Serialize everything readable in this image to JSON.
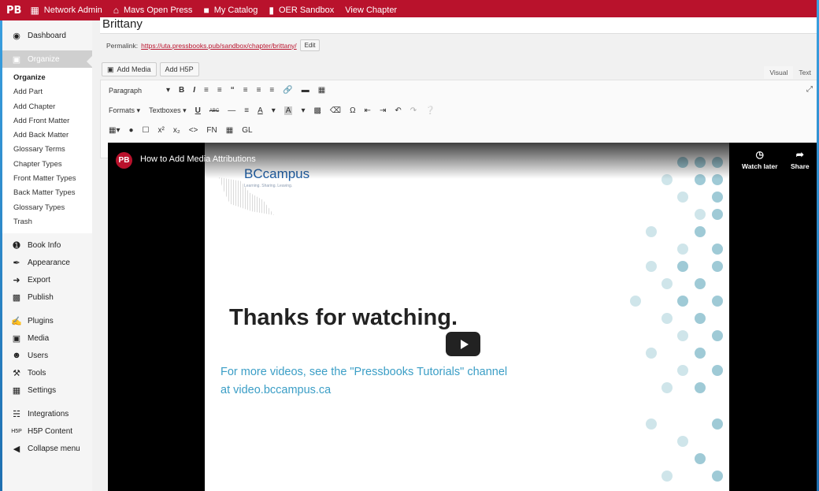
{
  "adminbar": {
    "logo": "PB",
    "items": [
      {
        "icon": "network-icon",
        "label": "Network Admin"
      },
      {
        "icon": "home-icon",
        "label": "Mavs Open Press"
      },
      {
        "icon": "folder-icon",
        "label": "My Catalog"
      },
      {
        "icon": "book-icon",
        "label": "OER Sandbox"
      },
      {
        "icon": "",
        "label": "View Chapter"
      }
    ]
  },
  "sidebar": {
    "dashboard": "Dashboard",
    "organize": "Organize",
    "submenu": [
      "Organize",
      "Add Part",
      "Add Chapter",
      "Add Front Matter",
      "Add Back Matter",
      "Glossary Terms",
      "Chapter Types",
      "Front Matter Types",
      "Back Matter Types",
      "Glossary Types",
      "Trash"
    ],
    "menu": [
      {
        "icon": "info-icon",
        "label": "Book Info"
      },
      {
        "icon": "brush-icon",
        "label": "Appearance"
      },
      {
        "icon": "export-icon",
        "label": "Export"
      },
      {
        "icon": "publish-icon",
        "label": "Publish"
      },
      {
        "icon": "plugins-icon",
        "label": "Plugins"
      },
      {
        "icon": "media-icon",
        "label": "Media"
      },
      {
        "icon": "users-icon",
        "label": "Users"
      },
      {
        "icon": "tools-icon",
        "label": "Tools"
      },
      {
        "icon": "settings-icon",
        "label": "Settings"
      },
      {
        "icon": "integrations-icon",
        "label": "Integrations"
      },
      {
        "icon": "h5p-icon",
        "label": "H5P Content"
      },
      {
        "icon": "collapse-icon",
        "label": "Collapse menu"
      }
    ]
  },
  "editor": {
    "title": "Brittany",
    "permalink_label": "Permalink:",
    "permalink_url": "https://uta.pressbooks.pub/sandbox/chapter/brittany/",
    "edit_label": "Edit",
    "add_media": "Add Media",
    "add_h5p": "Add H5P",
    "tab_visual": "Visual",
    "tab_text": "Text",
    "paragraph": "Paragraph",
    "formats": "Formats",
    "textboxes": "Textboxes",
    "fn": "FN",
    "gl": "GL"
  },
  "video": {
    "badge": "PB",
    "title": "How to Add Media Attributions",
    "watch_later": "Watch later",
    "share": "Share",
    "logo": "BCcampus",
    "logo_tagline": "Learning. Sharing. Leaving.",
    "thanks": "Thanks for watching.",
    "line1": "For more videos, see the \"Pressbooks Tutorials\" channel",
    "line2": "at video.bccampus.ca"
  }
}
